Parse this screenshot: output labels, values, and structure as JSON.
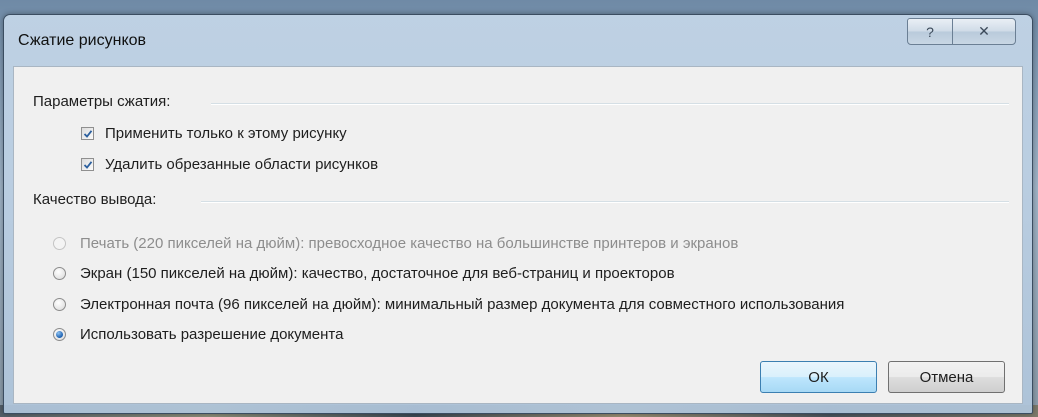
{
  "dialog": {
    "title": "Сжатие рисунков",
    "help_glyph": "?",
    "close_glyph": "✕"
  },
  "compression": {
    "group_label": "Параметры сжатия:",
    "apply_only_label": "Применить только к этому рисунку",
    "apply_only_checked": true,
    "delete_cropped_label": "Удалить обрезанные области рисунков",
    "delete_cropped_checked": true
  },
  "output": {
    "group_label": "Качество вывода:",
    "options": [
      {
        "label": "Печать (220 пикселей на дюйм): превосходное качество на большинстве принтеров и экранов",
        "enabled": false,
        "selected": false
      },
      {
        "label": "Экран (150 пикселей на дюйм): качество, достаточное для веб-страниц и проекторов",
        "enabled": true,
        "selected": false
      },
      {
        "label": "Электронная почта (96 пикселей на дюйм): минимальный размер документа для совместного использования",
        "enabled": true,
        "selected": false
      },
      {
        "label": "Использовать разрешение документа",
        "enabled": true,
        "selected": true
      }
    ]
  },
  "buttons": {
    "ok": "ОК",
    "cancel": "Отмена"
  },
  "colors": {
    "accent_radio": "#1b5fb0",
    "checkmark": "#2b5f9e",
    "default_button_border": "#3c7fb1"
  }
}
